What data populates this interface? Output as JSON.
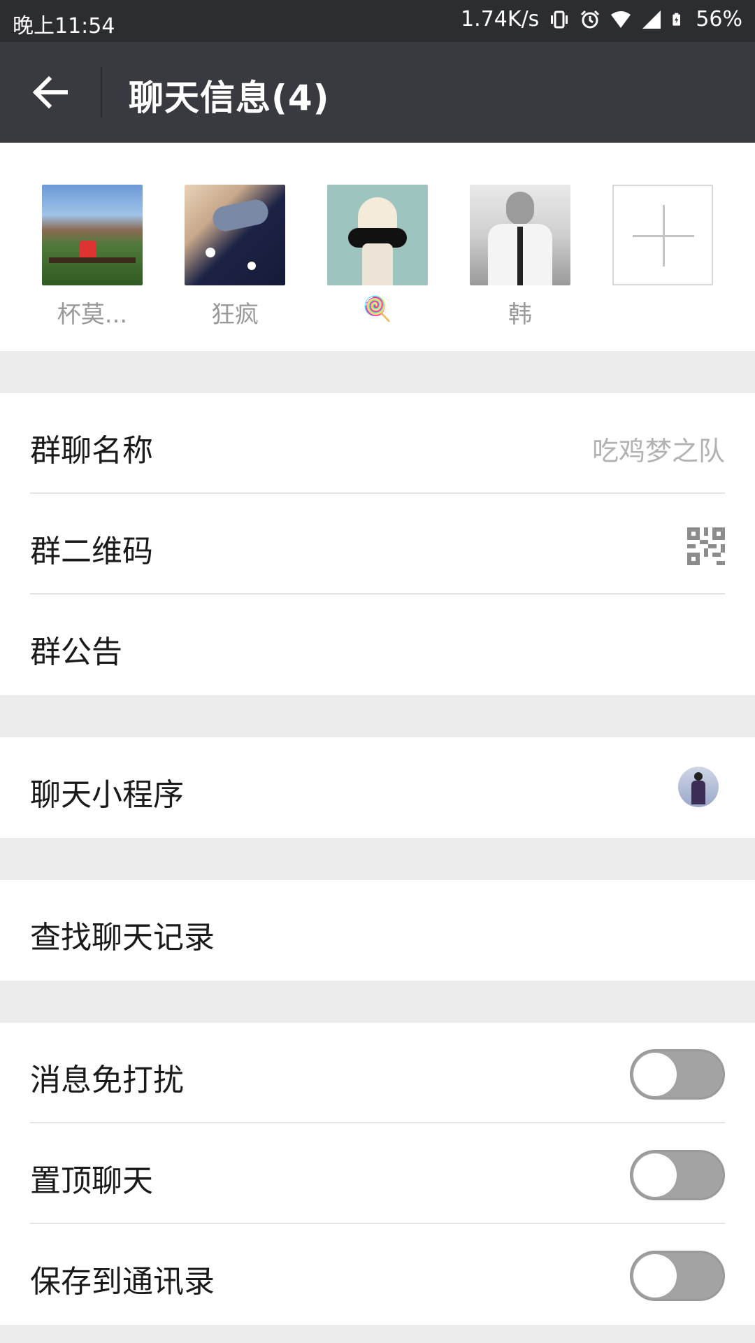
{
  "status_bar": {
    "time": "晚上11:54",
    "net_speed": "1.74K/s",
    "battery": "56%",
    "icons": [
      "vibrate-icon",
      "alarm-icon",
      "wifi-icon",
      "signal-icon",
      "battery-icon"
    ]
  },
  "header": {
    "back_icon": "arrow-left-icon",
    "title": "聊天信息(4)"
  },
  "members": [
    {
      "name": "杯莫...",
      "avatar": "photo-bench"
    },
    {
      "name": "狂疯",
      "avatar": "anime-ninja"
    },
    {
      "name": "🍭",
      "avatar": "anime-girl"
    },
    {
      "name": "韩",
      "avatar": "photo-man-tie"
    }
  ],
  "add_member_icon": "plus-icon",
  "group_settings": {
    "group_name_label": "群聊名称",
    "group_name_value": "吃鸡梦之队",
    "qr_label": "群二维码",
    "notice_label": "群公告"
  },
  "mini_program": {
    "label": "聊天小程序"
  },
  "search": {
    "label": "查找聊天记录"
  },
  "toggles": [
    {
      "label": "消息免打扰",
      "on": false
    },
    {
      "label": "置顶聊天",
      "on": false
    },
    {
      "label": "保存到通讯录",
      "on": false
    }
  ],
  "colors": {
    "status_bar_bg": "#2c2d30",
    "app_bar_bg": "#393a3f",
    "page_bg": "#ebebeb",
    "toggle_off": "#a3a3a3"
  }
}
